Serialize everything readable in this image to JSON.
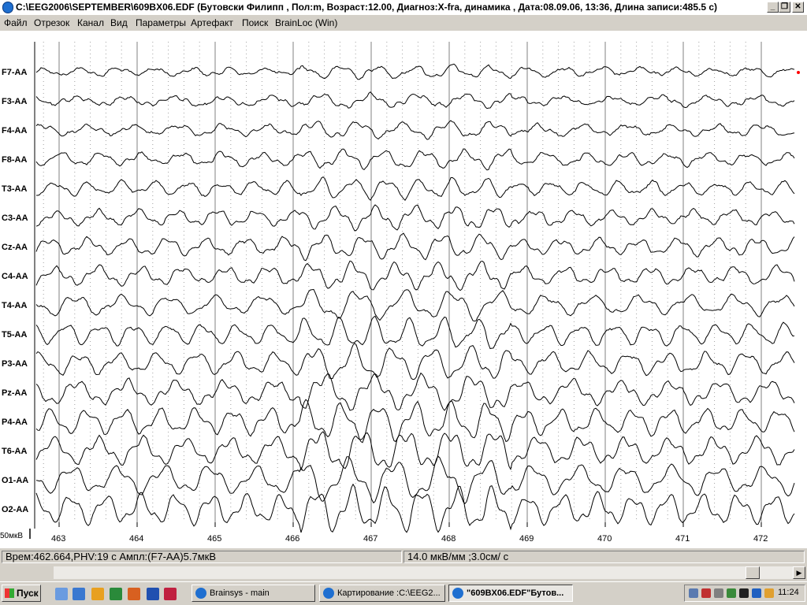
{
  "window": {
    "title": "C:\\EEG2006\\SEPTEMBER\\609BX06.EDF (Бутовски Филипп , Пол:m, Возраст:12.00, Диагноз:X-fra, динамика , Дата:08.09.06, 13:36, Длина записи:485.5 с)",
    "minimize": "_",
    "maximize": "❐",
    "close": "✕"
  },
  "menu": [
    "Файл",
    "Отрезок",
    "Канал",
    "Вид",
    "Параметры",
    "Артефакт",
    "Поиск",
    "BrainLoc (Win)"
  ],
  "eeg": {
    "channels": [
      "F7-AA",
      "F3-AA",
      "F4-AA",
      "F8-AA",
      "T3-AA",
      "C3-AA",
      "Cz-AA",
      "C4-AA",
      "T4-AA",
      "T5-AA",
      "P3-AA",
      "Pz-AA",
      "P4-AA",
      "T6-AA",
      "O1-AA",
      "O2-AA"
    ],
    "time_ticks": [
      "463",
      "464",
      "465",
      "466",
      "467",
      "468",
      "469",
      "470",
      "471",
      "472"
    ],
    "scale_label": "50мкВ",
    "colors": {
      "trace": "#000000",
      "grid": "#808080",
      "marker": "#ff0000"
    }
  },
  "status": {
    "position": "Врем:462.664,PHV:19 с Ампл:(F7-AA)5.7мкВ",
    "scale": "14.0 мкВ/мм ;3.0см/ с"
  },
  "taskbar": {
    "start": "Пуск",
    "tasks": [
      "Brainsys - main",
      "Картирование :C:\\EEG2...",
      "\"609BX06.EDF\"Бутов..."
    ],
    "clock": "11:24"
  }
}
